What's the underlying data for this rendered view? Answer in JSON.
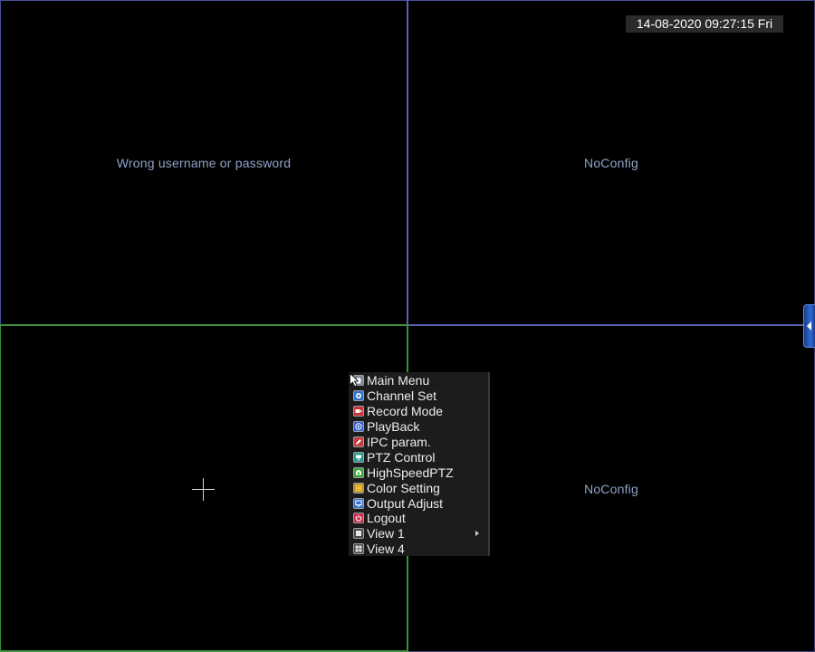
{
  "status_bar": {
    "datetime": "14-08-2020 09:27:15 Fri"
  },
  "panes": [
    {
      "id": 1,
      "message": "Wrong username or password"
    },
    {
      "id": 2,
      "message": "NoConfig"
    },
    {
      "id": 3,
      "message": ""
    },
    {
      "id": 4,
      "message": "NoConfig"
    }
  ],
  "context_menu": {
    "items": [
      {
        "label": "Main Menu",
        "icon": "home-icon",
        "icon_color": "#7d8590"
      },
      {
        "label": "Channel Set",
        "icon": "camera-icon",
        "icon_color": "#2f73c9"
      },
      {
        "label": "Record Mode",
        "icon": "record-icon",
        "icon_color": "#c83232"
      },
      {
        "label": "PlayBack",
        "icon": "playback-icon",
        "icon_color": "#2f5fc9"
      },
      {
        "label": "IPC param.",
        "icon": "pencil-icon",
        "icon_color": "#c83a3a"
      },
      {
        "label": "PTZ Control",
        "icon": "ptz-icon",
        "icon_color": "#2e9a8a"
      },
      {
        "label": "HighSpeedPTZ",
        "icon": "speed-dome-icon",
        "icon_color": "#3aa63a"
      },
      {
        "label": "Color Setting",
        "icon": "color-grid-icon",
        "icon_color": "#b08a2a"
      },
      {
        "label": "Output Adjust",
        "icon": "monitor-icon",
        "icon_color": "#3a6ec9"
      },
      {
        "label": "Logout",
        "icon": "power-icon",
        "icon_color": "#c82a4a"
      },
      {
        "label": "View 1",
        "icon": "single-view-icon",
        "icon_color": "#4a4a4a",
        "has_submenu": true
      },
      {
        "label": "View 4",
        "icon": "quad-view-icon",
        "icon_color": "#4a4a4a"
      }
    ]
  },
  "colors": {
    "active_channel_border": "#3c8f3c",
    "channel_border": "#5a5fae",
    "side_tab": "#2f6ad6"
  }
}
